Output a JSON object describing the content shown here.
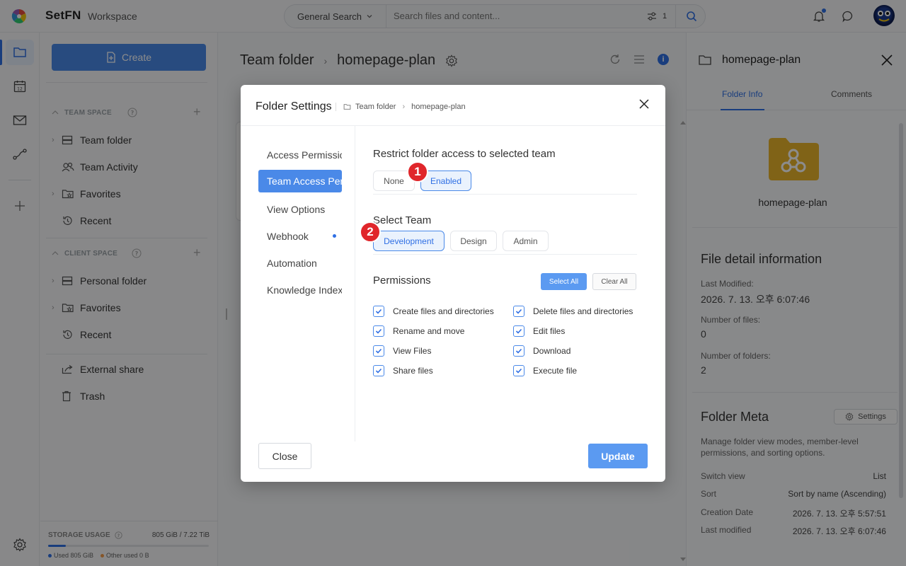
{
  "app": {
    "brand": "SetFN",
    "workspace": "Workspace"
  },
  "search": {
    "scope": "General Search",
    "placeholder": "Search files and content...",
    "filter_count": "1"
  },
  "sidebar": {
    "create_label": "Create",
    "team_space": {
      "title": "TEAM SPACE",
      "items": [
        {
          "label": "Team folder",
          "icon": "server-icon"
        },
        {
          "label": "Team Activity",
          "icon": "users-icon"
        },
        {
          "label": "Favorites",
          "icon": "star-folder-icon"
        },
        {
          "label": "Recent",
          "icon": "history-icon"
        }
      ]
    },
    "client_space": {
      "title": "CLIENT SPACE",
      "items": [
        {
          "label": "Personal folder",
          "icon": "server-icon"
        },
        {
          "label": "Favorites",
          "icon": "star-folder-icon"
        },
        {
          "label": "Recent",
          "icon": "history-icon"
        }
      ]
    },
    "extra": [
      {
        "label": "External share",
        "icon": "share-icon"
      },
      {
        "label": "Trash",
        "icon": "trash-icon"
      }
    ],
    "storage": {
      "title": "STORAGE USAGE",
      "value": "805 GiB / 7.22 TiB",
      "used": "Used 805 GiB",
      "other": "Other used 0 B",
      "used_fraction": 0.11
    }
  },
  "main": {
    "crumb_root": "Team folder",
    "crumb_current": "homepage-plan"
  },
  "modal": {
    "title": "Folder Settings",
    "crumb_root": "Team folder",
    "crumb_current": "homepage-plan",
    "nav": [
      "Access Permission",
      "Team Access Permission",
      "View Options",
      "Webhook",
      "Automation",
      "Knowledge Index"
    ],
    "restrict_label": "Restrict folder access to selected team",
    "restrict_options": [
      "None",
      "Enabled"
    ],
    "restrict_selected": "Enabled",
    "select_team_label": "Select Team",
    "teams": [
      "Development",
      "Design",
      "Admin"
    ],
    "team_selected": "Development",
    "permissions_label": "Permissions",
    "select_all": "Select All",
    "clear_all": "Clear All",
    "permissions": [
      {
        "label": "Create files and directories",
        "checked": true
      },
      {
        "label": "Delete files and directories",
        "checked": true
      },
      {
        "label": "Rename and move",
        "checked": true
      },
      {
        "label": "Edit files",
        "checked": true
      },
      {
        "label": "View Files",
        "checked": true
      },
      {
        "label": "Download",
        "checked": true
      },
      {
        "label": "Share files",
        "checked": true
      },
      {
        "label": "Execute file",
        "checked": true
      }
    ],
    "close_label": "Close",
    "update_label": "Update",
    "step_badges": [
      "1",
      "2"
    ]
  },
  "right_panel": {
    "title": "homepage-plan",
    "tabs": [
      "Folder Info",
      "Comments"
    ],
    "active_tab": "Folder Info",
    "folder_name": "homepage-plan",
    "detail_title": "File detail information",
    "last_modified_label": "Last Modified:",
    "last_modified_value": "2026. 7. 13. 오후 6:07:46",
    "files_label": "Number of files:",
    "files_value": "0",
    "folders_label": "Number of folders:",
    "folders_value": "2",
    "meta_title": "Folder Meta",
    "settings_label": "Settings",
    "meta_desc": "Manage folder view modes, member-level permissions, and sorting options.",
    "meta_rows": [
      {
        "label": "Switch view",
        "value": "List"
      },
      {
        "label": "Sort",
        "value": "Sort by name (Ascending)"
      },
      {
        "label": "Creation Date",
        "value": "2026. 7. 13. 오후 5:57:51"
      },
      {
        "label": "Last modified",
        "value": "2026. 7. 13. 오후 6:07:46"
      }
    ]
  },
  "colors": {
    "accent": "#4a89e8",
    "badge": "#e0262b",
    "folder": "#eab42a"
  }
}
